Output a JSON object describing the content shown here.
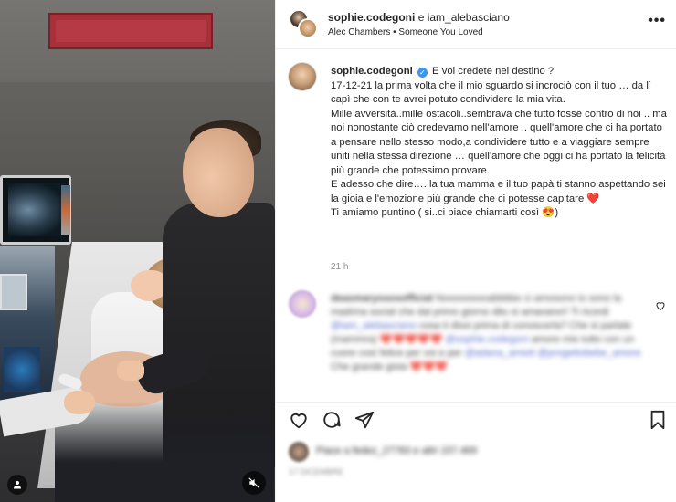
{
  "post": {
    "author": "sophie.codegoni",
    "collab_joiner": "e",
    "collaborator": "iam_alebasciano",
    "audio": "Alec Chambers • Someone You Loved",
    "more_icon": "more-horizontal-icon",
    "verified_icon": "verified-badge-icon",
    "caption_lines": [
      "E voi credete nel destino ?",
      "17-12-21 la prima volta che il mio sguardo si incrociò con il tuo … da lì capì che con te avrei potuto condividere la mia vita.",
      "Mille avversità..mille ostacoli..sembrava che tutto fosse contro di noi .. ma noi nonostante ciò credevamo nell'amore .. quell'amore che ci ha portato a pensare nello stesso modo,a condividere tutto e a viaggiare sempre uniti nella stessa direzione … quell'amore che oggi ci ha portato la felicità più grande che potessimo provare.",
      "E adesso che dire…. la tua mamma e il tuo papà ti stanno aspettando sei la gioia e l'emozione più grande che ci potesse capitare ❤️",
      "Ti amiamo puntino ( si..ci piace chiamarti così 😍)"
    ],
    "time_ago": "21 h"
  },
  "comment": {
    "username": "deasmaryssosofficial",
    "text_parts": [
      "Nooooooooabbbbe ci amosono io sono la madrina social che dal primo giorno ditu si amavano!! Ti ricordi ",
      "@iam_alebasciano",
      " cosa ti dissi prima di conoscerla? Che si parlate (mammra) ",
      "❤️❤️❤️❤️❤️",
      " ",
      "@sophie.codegoni",
      " amore mio tutto con un cuore così felice per voi e per ",
      "@adana_amioli @progettobebe_amore",
      " Che grande gioia ",
      "❤️❤️❤️"
    ],
    "like_icon": "heart-outline-icon"
  },
  "actions": {
    "icons": [
      "heart-outline-icon",
      "comment-icon",
      "share-icon",
      "bookmark-icon"
    ]
  },
  "likes": {
    "text": "Piace a fedez_27783 e altri 157.469"
  },
  "date": "17 DICEMBRE",
  "media": {
    "user_tag_icon": "user-tag-icon",
    "mute_icon": "muted-speaker-icon"
  },
  "colors": {
    "verified_blue": "#3897f0",
    "text": "#262626",
    "muted": "#8e8e8e",
    "border": "#efefef"
  }
}
